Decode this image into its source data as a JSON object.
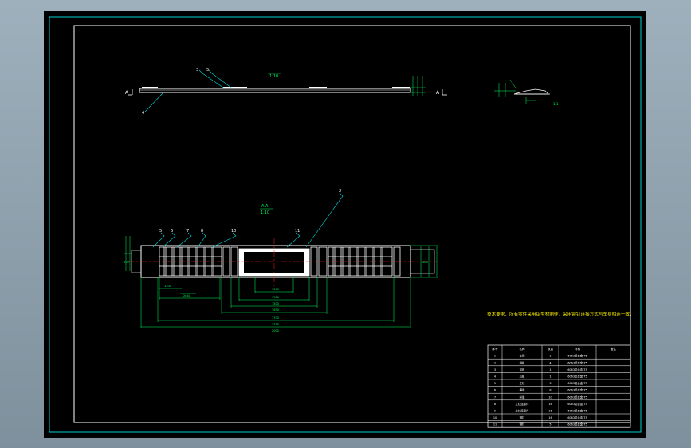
{
  "colors": {
    "paper": "#000000",
    "border": "#00d0d0",
    "line": "#ffffff",
    "dimension": "#00ff5a",
    "leader": "#00e0e0",
    "centerline": "#ff2020",
    "note": "#f2e600",
    "window_frame": "#8a9aa8"
  },
  "view_a": {
    "label_left": "A",
    "label_right": "A",
    "scale": "1:10",
    "callouts": [
      "3",
      "5",
      "4"
    ]
  },
  "detail_view": {
    "scale": "1:1"
  },
  "section_view": {
    "title": "A-A",
    "scale": "1:10",
    "callouts": [
      "5",
      "6",
      "7",
      "8",
      "10",
      "11",
      "2"
    ],
    "dims": [
      "1200",
      "1300",
      "1500",
      "1650",
      "1700",
      "1750",
      "2000",
      "2640",
      "1200",
      "200",
      "100"
    ]
  },
  "note": "技术要求、所有零件采用铝型材制作，采用铆钉连接方式与车身相连一致。",
  "bom": {
    "headers": [
      "序号",
      "名称",
      "数量",
      "材料",
      "备注"
    ],
    "rows": [
      [
        "1",
        "车厢",
        "1",
        "6063铝合金-T5",
        ""
      ],
      [
        "2",
        "侧板",
        "4",
        "6063铝合金-T5",
        ""
      ],
      [
        "3",
        "前板",
        "1",
        "6063铝合金-T5",
        ""
      ],
      [
        "4",
        "后板",
        "1",
        "6063铝合金-T5",
        ""
      ],
      [
        "5",
        "立柱",
        "3",
        "6063铝合金-T5",
        ""
      ],
      [
        "6",
        "横梁",
        "8",
        "6063铝合金-T5",
        ""
      ],
      [
        "7",
        "纵梁",
        "10",
        "6063铝合金-T5",
        ""
      ],
      [
        "8",
        "立柱连接件",
        "16",
        "6063铝合金-T5",
        ""
      ],
      [
        "9",
        "立柱连接件",
        "16",
        "6063铝合金-T5",
        ""
      ],
      [
        "10",
        "铆钉",
        "16",
        "6063铝合金-T5",
        ""
      ],
      [
        "11",
        "铆钉",
        "5",
        "6063铝合金-T5",
        ""
      ]
    ]
  }
}
